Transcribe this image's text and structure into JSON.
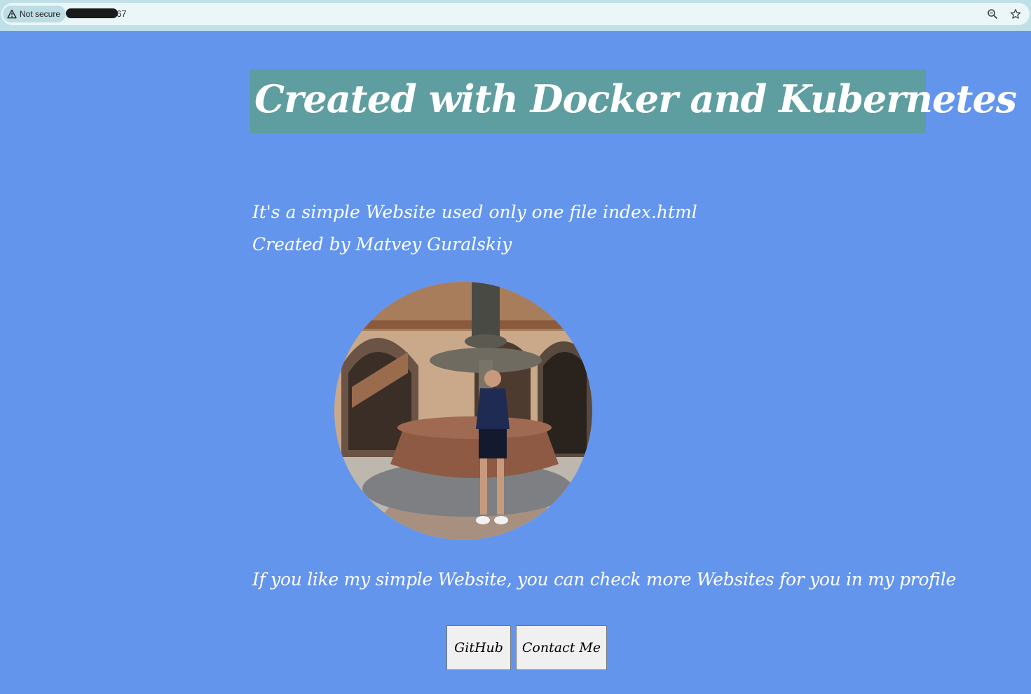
{
  "browser": {
    "security_label": "Not secure",
    "url_visible_suffix": "67",
    "icons": [
      "warning-icon",
      "zoom-icon",
      "star-icon"
    ]
  },
  "page": {
    "title": "Created with Docker and Kubernetes",
    "intro_line_1": "It's a simple Website used only one file index.html",
    "intro_line_2": "Created by Matvey Guralskiy",
    "cta_text": "If you like my simple Website, you can check more Websites for you in my profile",
    "buttons": {
      "github": "GitHub",
      "contact": "Contact Me"
    }
  },
  "colors": {
    "background": "#6495ed",
    "title_box": "#5f9ea0",
    "text": "#ffffff",
    "button_bg": "#f0f0f0"
  }
}
